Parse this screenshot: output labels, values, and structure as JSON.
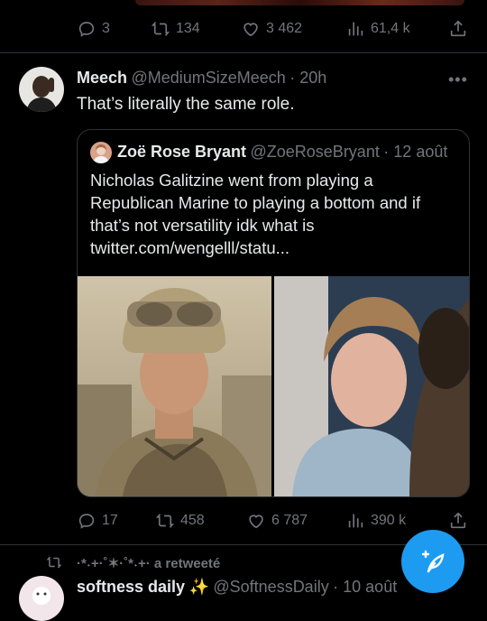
{
  "prev_tweet": {
    "actions": {
      "replies": "3",
      "retweets": "134",
      "likes": "3 462",
      "views": "61,4 k"
    }
  },
  "tweet": {
    "author_name": "Meech",
    "author_handle": "@MediumSizeMeech",
    "time": "· 20h",
    "text": "That’s literally the same role.",
    "quote": {
      "author_name": "Zoë Rose Bryant",
      "author_handle": "@ZoeRoseBryant",
      "time": "· 12 août",
      "lines": [
        "Nicholas Galitzine went from playing a",
        "Republican Marine to playing a bottom and if",
        "that’s not versatility idk what is",
        "twitter.com/wengelll/statu..."
      ]
    },
    "actions": {
      "replies": "17",
      "retweets": "458",
      "likes": "6 787",
      "views": "390 k"
    }
  },
  "next_tweet": {
    "retweet_label": "·*˖+·˚✶·˚*˖+· a retweeté",
    "author_name": "softness daily",
    "emoji": "✨",
    "author_handle": "@SoftnessDaily",
    "time": "· 10 août"
  },
  "colors": {
    "accent": "#1d9bf0",
    "text": "#e7e9ea",
    "muted": "#71767b",
    "border": "#2f3336"
  }
}
